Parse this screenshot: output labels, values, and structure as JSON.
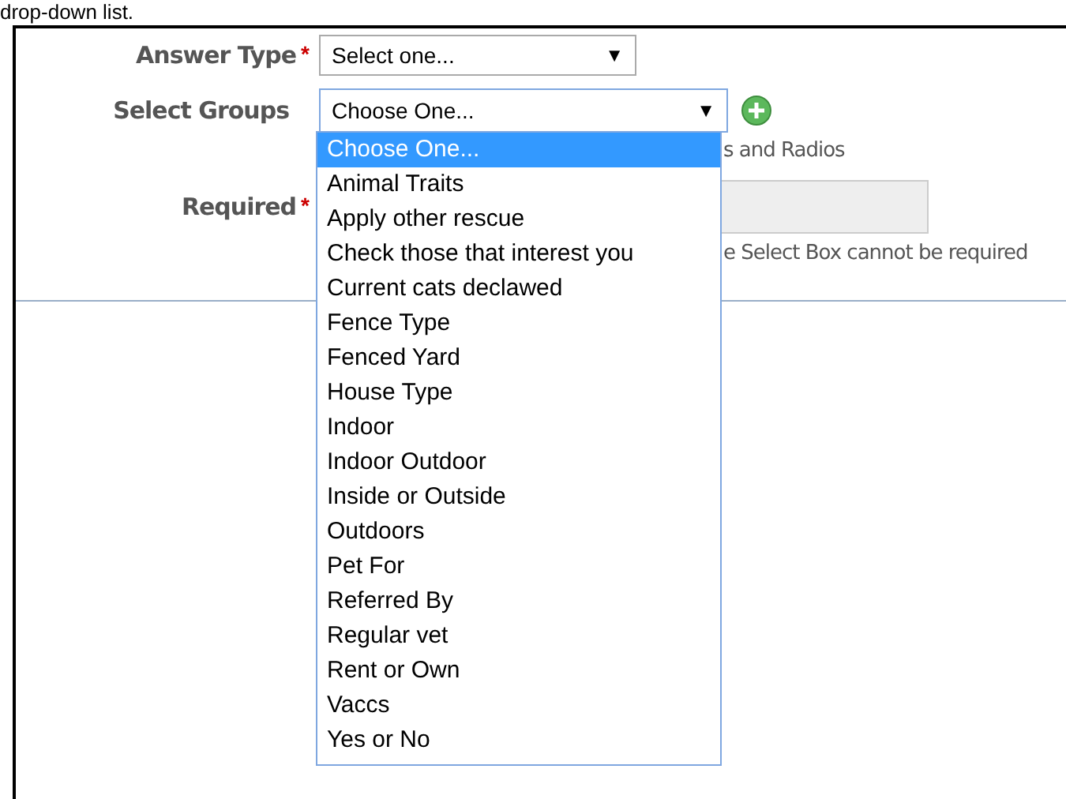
{
  "intro_text": "drop-down list.",
  "answer_type": {
    "label": "Answer Type",
    "required_mark": "*",
    "value": "Select one...",
    "arrow": "▼"
  },
  "select_groups": {
    "label": "Select Groups",
    "value": "Choose One...",
    "arrow": "▼",
    "expanded": true,
    "note": "s and Radios",
    "options": [
      {
        "label": "Choose One...",
        "selected": true
      },
      {
        "label": "Animal Traits",
        "selected": false
      },
      {
        "label": "Apply other rescue",
        "selected": false
      },
      {
        "label": "Check those that interest you",
        "selected": false
      },
      {
        "label": "Current cats declawed",
        "selected": false
      },
      {
        "label": "Fence Type",
        "selected": false
      },
      {
        "label": "Fenced Yard",
        "selected": false
      },
      {
        "label": "House Type",
        "selected": false
      },
      {
        "label": "Indoor",
        "selected": false
      },
      {
        "label": "Indoor Outdoor",
        "selected": false
      },
      {
        "label": "Inside or Outside",
        "selected": false
      },
      {
        "label": "Outdoors",
        "selected": false
      },
      {
        "label": "Pet For",
        "selected": false
      },
      {
        "label": "Referred By",
        "selected": false
      },
      {
        "label": "Regular vet",
        "selected": false
      },
      {
        "label": "Rent or Own",
        "selected": false
      },
      {
        "label": "Vaccs",
        "selected": false
      },
      {
        "label": "Yes or No",
        "selected": false
      }
    ]
  },
  "required": {
    "label": "Required",
    "required_mark": "*",
    "disabled": true,
    "note": "e Select Box cannot be required"
  }
}
